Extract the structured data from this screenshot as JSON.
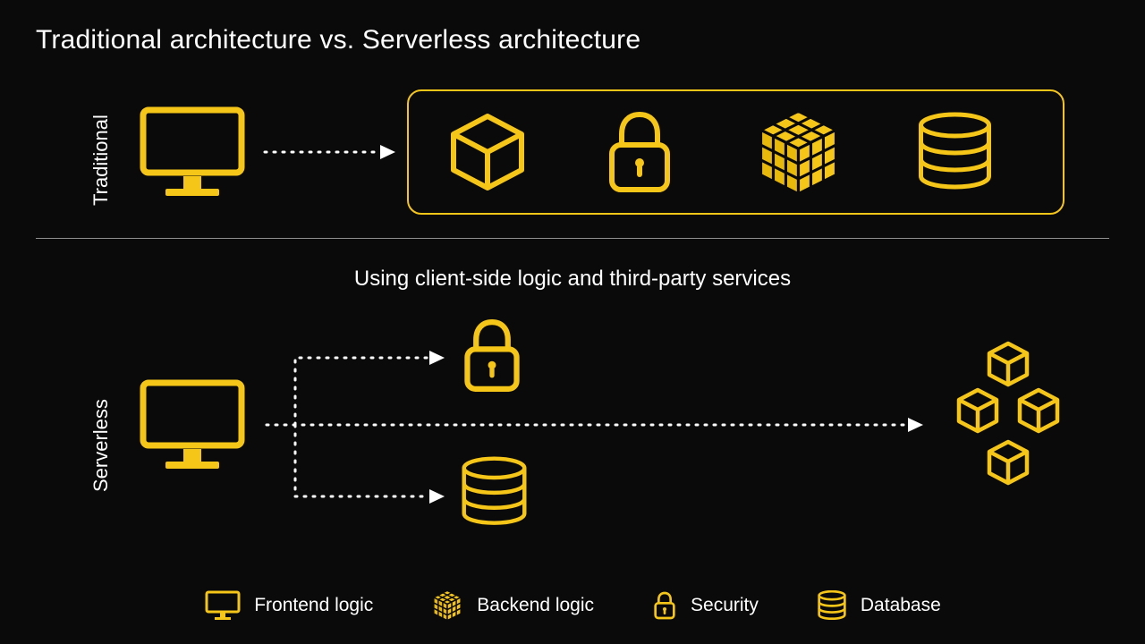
{
  "title": "Traditional architecture vs. Serverless architecture",
  "sections": {
    "traditional": {
      "label": "Traditional"
    },
    "serverless": {
      "label": "Serverless",
      "subtitle": "Using client-side logic and third-party services"
    }
  },
  "legend": {
    "frontend": "Frontend logic",
    "backend": "Backend logic",
    "security": "Security",
    "database": "Database"
  },
  "colors": {
    "accent": "#f5c518",
    "accent_fill": "#e8b80a"
  }
}
